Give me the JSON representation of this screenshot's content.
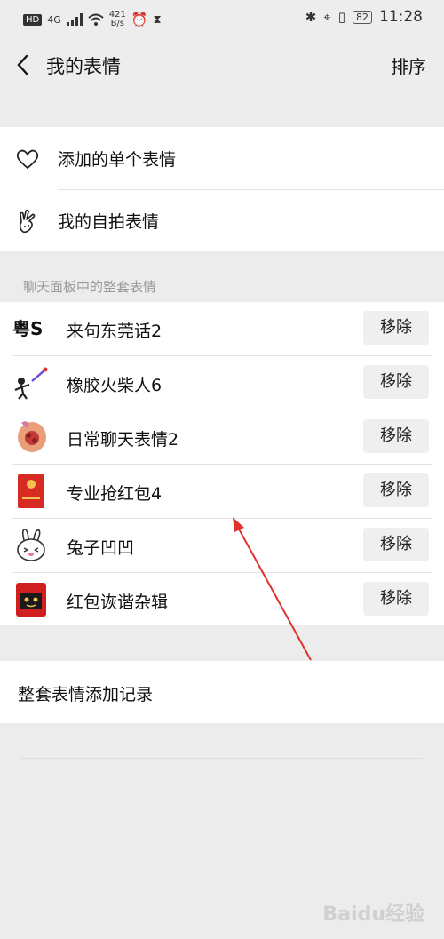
{
  "status_bar": {
    "left_badge": "HD",
    "network": "4G",
    "speed_value": "421",
    "speed_unit": "B/s",
    "battery": "82",
    "time": "11:28"
  },
  "header": {
    "title": "我的表情",
    "sort_label": "排序"
  },
  "top_list": {
    "items": [
      {
        "label": "添加的单个表情",
        "icon": "heart-icon"
      },
      {
        "label": "我的自拍表情",
        "icon": "selfie-hand-icon"
      }
    ]
  },
  "section_label": "聊天面板中的整套表情",
  "packs": {
    "remove_label": "移除",
    "items": [
      {
        "name": "来句东莞话2",
        "thumb": "cantonese-text-thumb",
        "thumb_text": "粤S"
      },
      {
        "name": "橡胶火柴人6",
        "thumb": "stickman-thumb"
      },
      {
        "name": "日常聊天表情2",
        "thumb": "bouquet-thumb"
      },
      {
        "name": "专业抢红包4",
        "thumb": "red-envelope-thumb"
      },
      {
        "name": "兔子凹凹",
        "thumb": "rabbit-thumb"
      },
      {
        "name": "红包诙谐杂辑",
        "thumb": "red-envelope-face-thumb"
      }
    ]
  },
  "history_label": "整套表情添加记录",
  "watermark": "Baidu经验"
}
